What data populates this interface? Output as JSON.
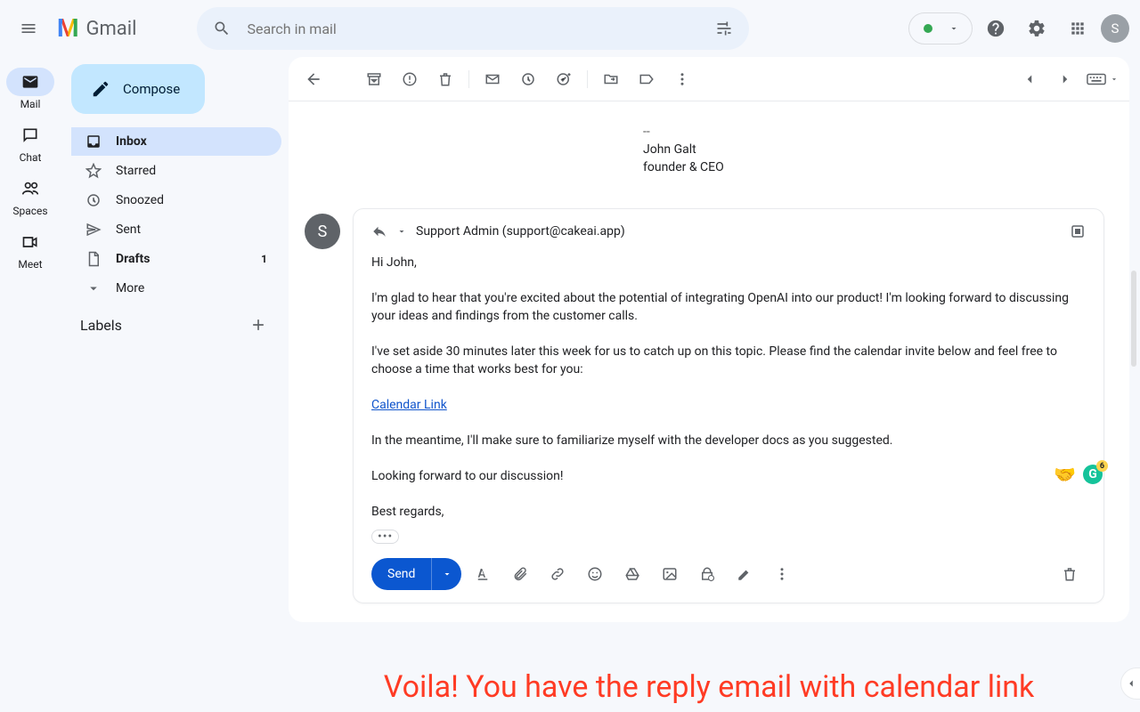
{
  "header": {
    "product_name": "Gmail",
    "search_placeholder": "Search in mail",
    "avatar_initial": "S"
  },
  "mini_nav": [
    {
      "id": "mail",
      "label": "Mail"
    },
    {
      "id": "chat",
      "label": "Chat"
    },
    {
      "id": "spaces",
      "label": "Spaces"
    },
    {
      "id": "meet",
      "label": "Meet"
    }
  ],
  "sidebar": {
    "compose": "Compose",
    "items": [
      {
        "id": "inbox",
        "label": "Inbox",
        "bold": true,
        "active": true
      },
      {
        "id": "starred",
        "label": "Starred"
      },
      {
        "id": "snoozed",
        "label": "Snoozed"
      },
      {
        "id": "sent",
        "label": "Sent"
      },
      {
        "id": "drafts",
        "label": "Drafts",
        "bold": true,
        "count": "1"
      },
      {
        "id": "more",
        "label": "More"
      }
    ],
    "labels_heading": "Labels"
  },
  "previous_message": {
    "sig_dashes": "--",
    "sig_name": "John Galt",
    "sig_title": "founder & CEO"
  },
  "compose": {
    "from_initial": "S",
    "to_line": "Support Admin (support@cakeai.app)",
    "body": {
      "p1": "Hi John,",
      "p2": "I'm glad to hear that you're excited about the potential of integrating OpenAI into our product! I'm looking forward to discussing your ideas and findings from the customer calls.",
      "p3": "I've set aside 30 minutes later this week for us to catch up on this topic. Please find the calendar invite below and feel free to choose a time that works best for you:",
      "link": "Calendar Link",
      "p4": "In the meantime, I'll make sure to familiarize myself with the developer docs as you suggested.",
      "p5": "Looking forward to our discussion!",
      "p6": "Best regards,"
    },
    "send_label": "Send",
    "grammarly_badge": "6"
  },
  "caption": "Voila! You have the reply email with calendar link"
}
